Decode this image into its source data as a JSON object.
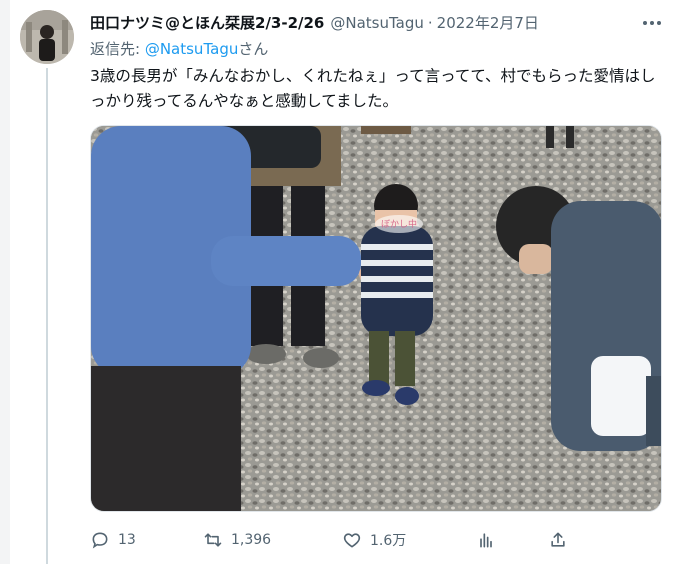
{
  "tweet": {
    "display_name": "田口ナツミ@とほん栞展2/3-2/26",
    "handle": "@NatsuTagu",
    "separator": "·",
    "date": "2022年2月7日",
    "reply_prefix": "返信先: ",
    "reply_to": "@NatsuTagu",
    "reply_suffix": "さん",
    "text": "3歳の長男が「みんなおかし、くれたねぇ」って言ってて、村でもらった愛情はしっかり残ってるんやなぁと感動してました。",
    "media": {
      "blur_label": "ぼかし中"
    }
  },
  "actions": {
    "reply_count": "13",
    "retweet_count": "1,396",
    "like_count": "1.6万"
  },
  "icons": [
    "more-icon",
    "reply-icon",
    "retweet-icon",
    "like-icon",
    "analytics-icon",
    "share-icon"
  ],
  "colors": {
    "link": "#1d9bf0",
    "secondary_text": "#536471",
    "primary_text": "#0f1419"
  }
}
